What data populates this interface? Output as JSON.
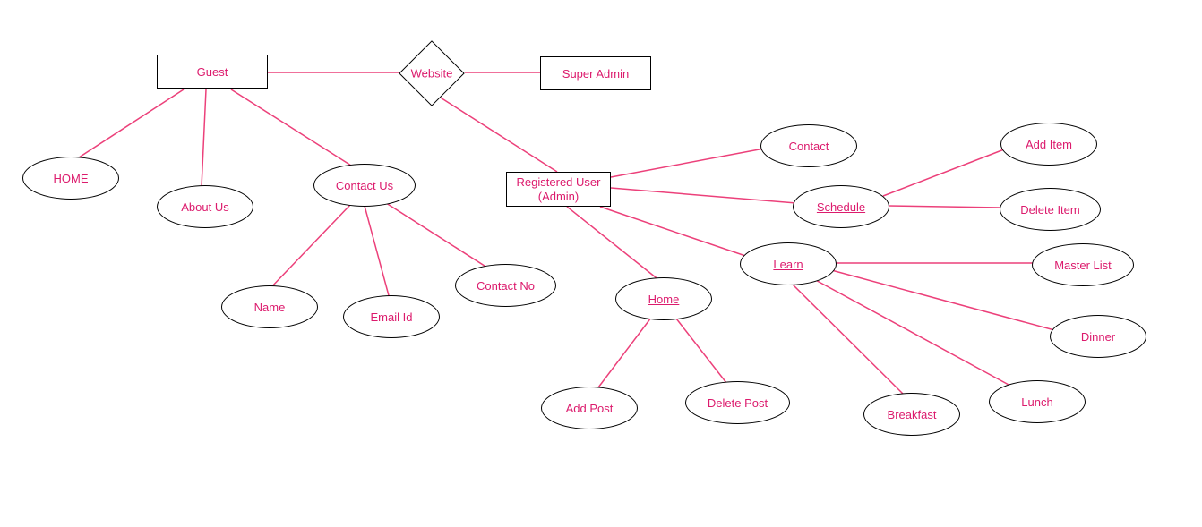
{
  "nodes": {
    "guest": "Guest",
    "website": "Website",
    "superadmin": "Super Admin",
    "home": "HOME",
    "aboutus": "About Us",
    "contactus": "Contact Us",
    "name": "Name",
    "emailid": "Email Id",
    "contactno": "Contact No",
    "registereduser_l1": "Registered User",
    "registereduser_l2": "(Admin)",
    "contact": "Contact",
    "schedule": "Schedule",
    "additem": "Add Item",
    "deleteitem": "Delete Item",
    "learn": "Learn",
    "home2": "Home",
    "addpost": "Add Post",
    "deletepost": "Delete Post",
    "breakfast": "Breakfast",
    "lunch": "Lunch",
    "dinner": "Dinner",
    "masterlist": "Master List"
  },
  "edges": [
    {
      "from": "guest",
      "to": "website"
    },
    {
      "from": "website",
      "to": "superadmin"
    },
    {
      "from": "website",
      "to": "registereduser"
    },
    {
      "from": "guest",
      "to": "home"
    },
    {
      "from": "guest",
      "to": "aboutus"
    },
    {
      "from": "guest",
      "to": "contactus"
    },
    {
      "from": "contactus",
      "to": "name"
    },
    {
      "from": "contactus",
      "to": "emailid"
    },
    {
      "from": "contactus",
      "to": "contactno"
    },
    {
      "from": "registereduser",
      "to": "contact"
    },
    {
      "from": "registereduser",
      "to": "schedule"
    },
    {
      "from": "registereduser",
      "to": "learn"
    },
    {
      "from": "registereduser",
      "to": "home2"
    },
    {
      "from": "schedule",
      "to": "additem"
    },
    {
      "from": "schedule",
      "to": "deleteitem"
    },
    {
      "from": "learn",
      "to": "masterlist"
    },
    {
      "from": "learn",
      "to": "dinner"
    },
    {
      "from": "learn",
      "to": "lunch"
    },
    {
      "from": "learn",
      "to": "breakfast"
    },
    {
      "from": "home2",
      "to": "addpost"
    },
    {
      "from": "home2",
      "to": "deletepost"
    }
  ]
}
